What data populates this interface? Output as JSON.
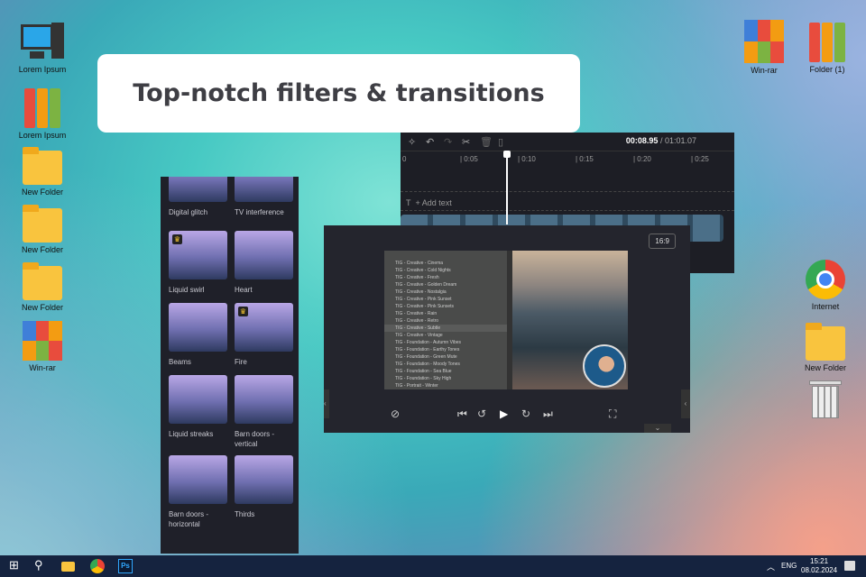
{
  "banner": {
    "title": "Top-notch filters & transitions"
  },
  "desktop_left": [
    {
      "label": "Lorem Ipsum",
      "icon": "computer-icon"
    },
    {
      "label": "Lorem Ipsum",
      "icon": "binders-icon"
    },
    {
      "label": "New Folder",
      "icon": "folder-icon"
    },
    {
      "label": "New Folder",
      "icon": "folder-icon"
    },
    {
      "label": "New Folder",
      "icon": "folder-icon"
    },
    {
      "label": "Win-rar",
      "icon": "winrar-icon"
    }
  ],
  "desktop_right": {
    "winrar": "Win-rar",
    "folder1": "Folder (1)",
    "internet": "Internet",
    "newfolder": "New Folder",
    "trash": ""
  },
  "filters": [
    {
      "label": "Digital glitch"
    },
    {
      "label": "TV interference"
    },
    {
      "label": "Liquid swirl",
      "premium": true
    },
    {
      "label": "Heart"
    },
    {
      "label": "Beams"
    },
    {
      "label": "Fire",
      "premium": true
    },
    {
      "label": "Liquid streaks"
    },
    {
      "label": "Barn doors - vertical"
    },
    {
      "label": "Barn doors - horizontal"
    },
    {
      "label": "Thirds"
    }
  ],
  "timeline": {
    "current": "00:08.95",
    "total": "/ 01:01.07",
    "ticks": [
      "0",
      "0:05",
      "0:10",
      "0:15",
      "0:20",
      "0:25"
    ],
    "add_text": "+ Add text",
    "playhead_seconds": 8.95
  },
  "preview": {
    "aspect": "16:9",
    "list": [
      "TIG - Creative - Cinema",
      "TIG - Creative - Cold Nights",
      "TIG - Creative - Fresh",
      "TIG - Creative - Golden Dream",
      "TIG - Creative - Nostalgia",
      "TIG - Creative - Pink Sunset",
      "TIG - Creative - Pink Sunsets",
      "TIG - Creative - Rain",
      "TIG - Creative - Retro",
      "TIG - Creative - Subtle",
      "TIG - Creative - Vintage",
      "TIG - Foundation - Autumn Vibes",
      "TIG - Foundation - Earthy Tones",
      "TIG - Foundation - Green Mute",
      "TIG - Foundation - Moody Tones",
      "TIG - Foundation - Sea Blue",
      "TIG - Foundation - Sky High",
      "TIG - Portrait - Winter"
    ],
    "selected_index": 9
  },
  "taskbar": {
    "lang": "ENG",
    "time": "15:21",
    "date": "08.02.2024",
    "ps": "Ps"
  },
  "colors": {
    "panel": "#1f2029",
    "taskbar": "#15233f",
    "banner_text": "#3e3e44"
  }
}
